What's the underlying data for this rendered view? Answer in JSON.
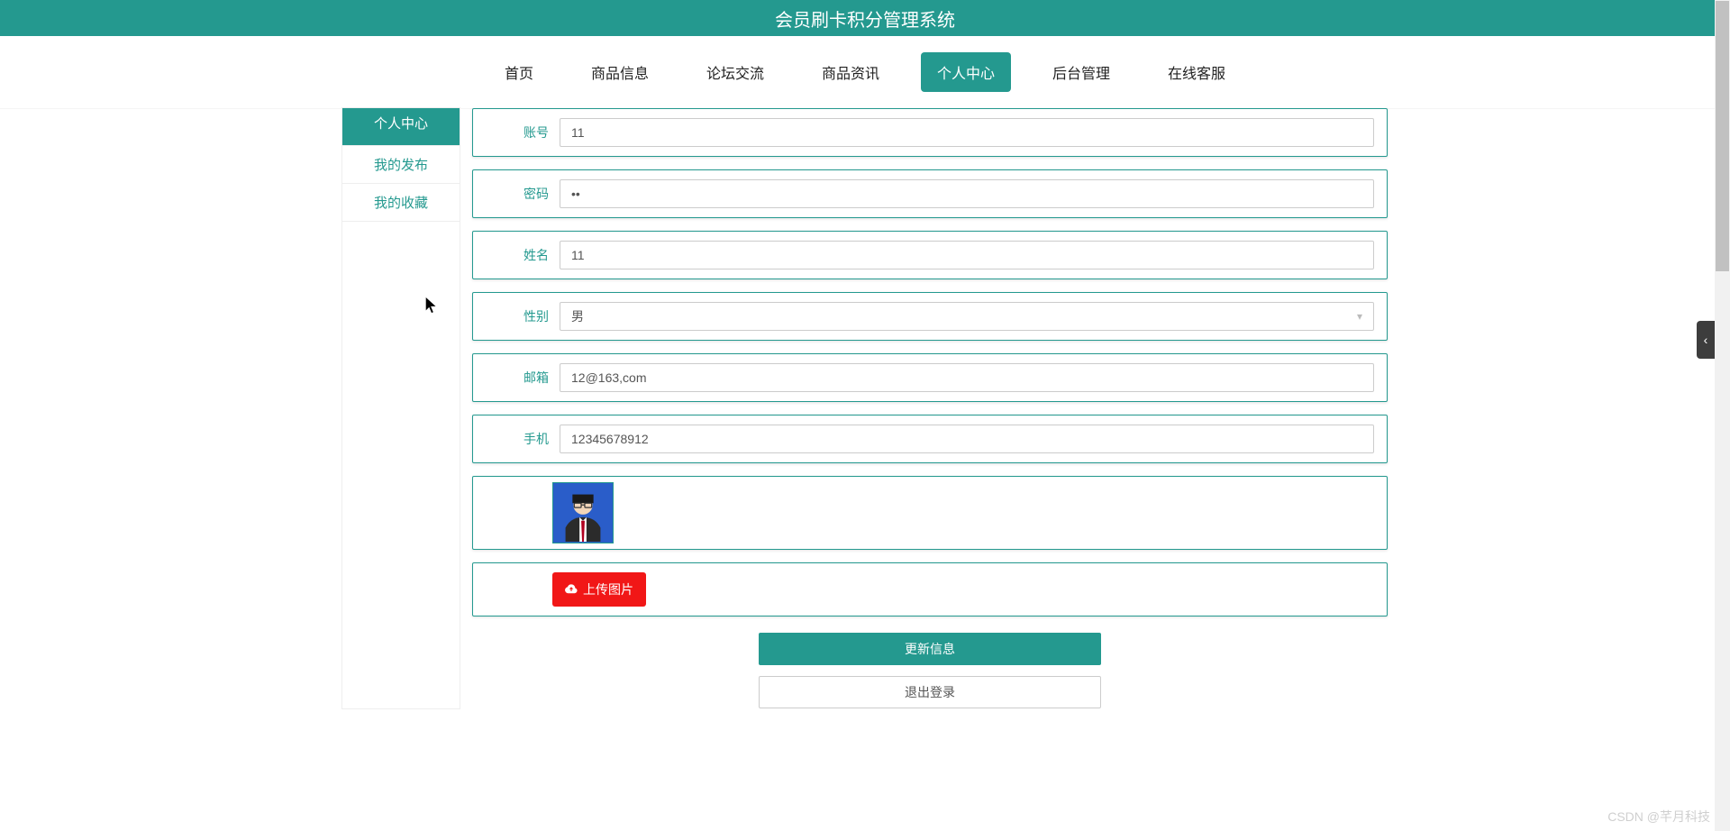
{
  "header": {
    "title": "会员刷卡积分管理系统"
  },
  "nav": {
    "items": [
      {
        "label": "首页"
      },
      {
        "label": "商品信息"
      },
      {
        "label": "论坛交流"
      },
      {
        "label": "商品资讯"
      },
      {
        "label": "个人中心"
      },
      {
        "label": "后台管理"
      },
      {
        "label": "在线客服"
      }
    ],
    "activeIndex": 4
  },
  "sidebar": {
    "items": [
      {
        "label": "个人中心"
      },
      {
        "label": "我的发布"
      },
      {
        "label": "我的收藏"
      }
    ],
    "activeIndex": 0
  },
  "form": {
    "account": {
      "label": "账号",
      "value": "11"
    },
    "password": {
      "label": "密码",
      "value": "••"
    },
    "name": {
      "label": "姓名",
      "value": "11"
    },
    "gender": {
      "label": "性别",
      "value": "男"
    },
    "email": {
      "label": "邮箱",
      "value": "12@163,com"
    },
    "phone": {
      "label": "手机",
      "value": "12345678912"
    },
    "upload_btn": "上传图片"
  },
  "buttons": {
    "update": "更新信息",
    "logout": "退出登录"
  },
  "watermark": "CSDN @芊月科技",
  "sideTabGlyph": "‹"
}
